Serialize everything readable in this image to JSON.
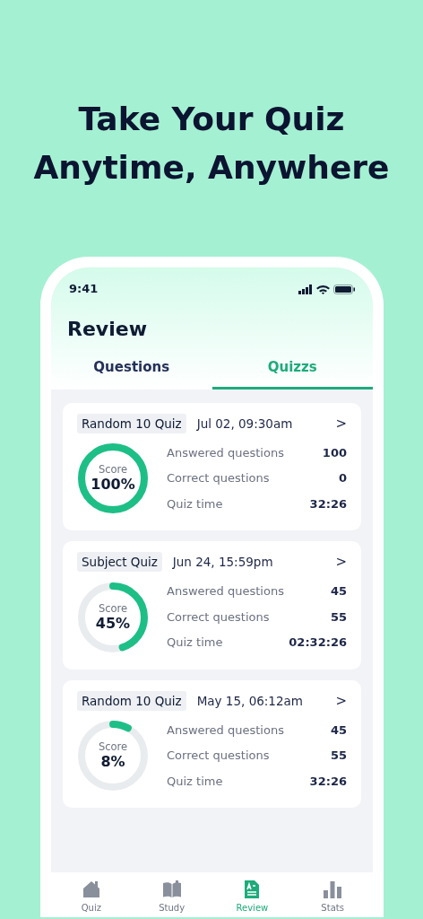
{
  "headline": [
    "Take Your Quiz",
    "Anytime, Anywhere"
  ],
  "status_bar": {
    "time": "9:41"
  },
  "title": "Review",
  "tabs": [
    {
      "label": "Questions",
      "selected": false
    },
    {
      "label": "Quizzs",
      "selected": true
    }
  ],
  "quizzes": [
    {
      "type": "Random 10 Quiz",
      "date": "Jul 02, 09:30am",
      "chevron": ">",
      "score_label": "Score",
      "score": "100%",
      "level": 1,
      "stats": [
        {
          "label": "Answered questions",
          "value": "100"
        },
        {
          "label": "Correct questions",
          "value": "0"
        },
        {
          "label": "Quiz time",
          "value": "32:26"
        }
      ]
    },
    {
      "type": "Subject Quiz",
      "date": "Jun 24, 15:59pm",
      "chevron": ">",
      "score_label": "Score",
      "score": "45%",
      "level": 0.45,
      "stats": [
        {
          "label": "Answered questions",
          "value": "45"
        },
        {
          "label": "Correct questions",
          "value": "55"
        },
        {
          "label": "Quiz time",
          "value": "02:32:26"
        }
      ]
    },
    {
      "type": "Random 10 Quiz",
      "date": "May 15, 06:12am",
      "chevron": ">",
      "score_label": "Score",
      "score": "8%",
      "level": 0.08,
      "stats": [
        {
          "label": "Answered questions",
          "value": "45"
        },
        {
          "label": "Correct questions",
          "value": "55"
        },
        {
          "label": "Quiz time",
          "value": "32:26"
        }
      ]
    }
  ],
  "bottom_nav": [
    {
      "kind": "home",
      "label": "Quiz",
      "selected": false
    },
    {
      "kind": "book",
      "label": "Study",
      "selected": false
    },
    {
      "kind": "doc",
      "label": "Review",
      "selected": true
    },
    {
      "kind": "stats",
      "label": "Stats",
      "selected": false
    }
  ]
}
